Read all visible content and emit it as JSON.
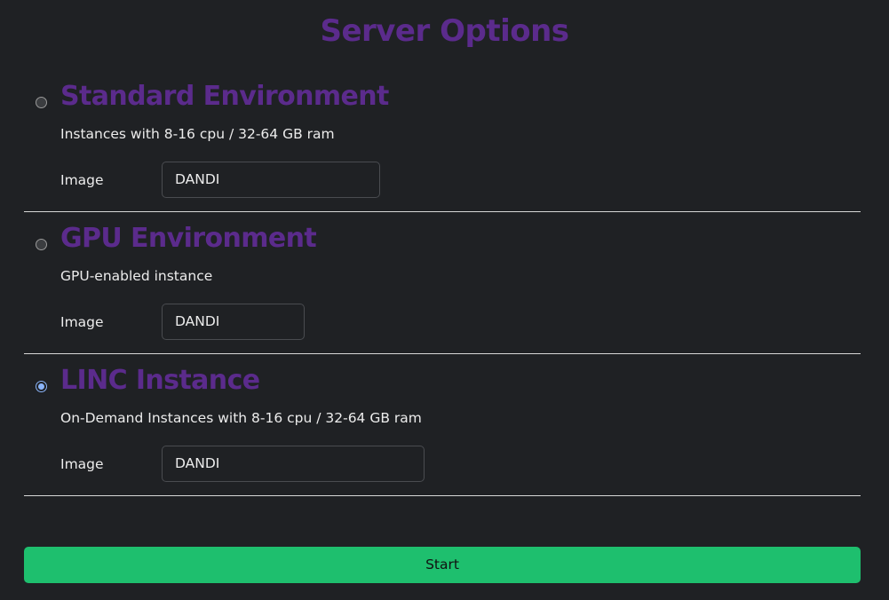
{
  "page": {
    "title": "Server Options"
  },
  "options": [
    {
      "title": "Standard Environment",
      "description": "Instances with 8-16 cpu / 32-64 GB ram",
      "image_label": "Image",
      "image_value": "DANDI",
      "selected": false
    },
    {
      "title": "GPU Environment",
      "description": "GPU-enabled instance",
      "image_label": "Image",
      "image_value": "DANDI",
      "selected": false
    },
    {
      "title": "LINC Instance",
      "description": "On-Demand Instances with 8-16 cpu / 32-64 GB ram",
      "image_label": "Image",
      "image_value": "DANDI",
      "selected": true
    }
  ],
  "actions": {
    "start_label": "Start"
  },
  "colors": {
    "background": "#1f2124",
    "heading": "#5b2b8c",
    "start_button": "#1ebf6e",
    "radio_checked": "#8ab4f8",
    "divider": "#d7d7d7"
  }
}
